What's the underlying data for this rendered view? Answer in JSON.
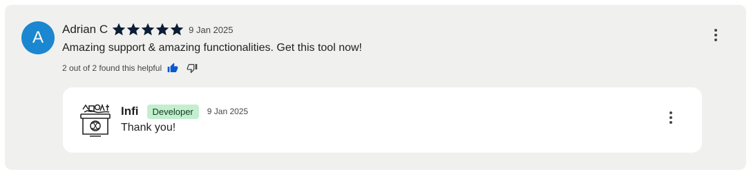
{
  "review": {
    "avatar_letter": "A",
    "author": "Adrian C",
    "rating": 5,
    "rating_max": 5,
    "date": "9 Jan 2025",
    "text": "Amazing support & amazing functionalities. Get this tool now!",
    "helpful_text": "2 out of 2 found this helpful",
    "icons": {
      "more": "more-vert-icon",
      "thumb_up": "thumb-up-icon",
      "thumb_down": "thumb-down-icon",
      "star": "star-icon"
    }
  },
  "reply": {
    "developer_name": "Infi",
    "badge": "Developer",
    "date": "9 Jan 2025",
    "text": "Thank you!",
    "icons": {
      "logo": "infi-logo-icon",
      "more": "more-vert-icon"
    }
  },
  "colors": {
    "card_bg": "#f0f0ee",
    "avatar_bg": "#1a87d0",
    "star": "#0b1e35",
    "thumb_up_active": "#0b57d0",
    "badge_bg": "#c4eed0",
    "reply_bg": "#ffffff"
  }
}
